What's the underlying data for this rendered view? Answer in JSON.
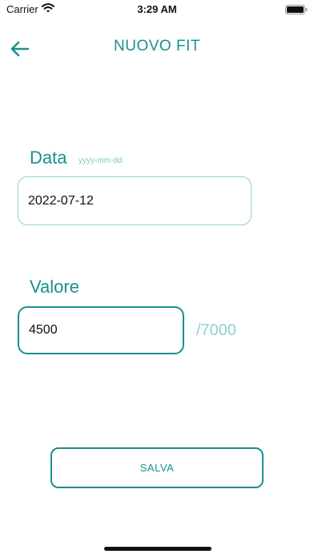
{
  "status_bar": {
    "carrier": "Carrier",
    "time": "3:29 AM",
    "wifi_icon": "wifi-icon",
    "battery_icon": "battery-icon"
  },
  "header": {
    "back_icon": "arrow-left-icon",
    "title": "NUOVO FIT"
  },
  "form": {
    "date": {
      "label": "Data",
      "hint": "yyyy-mm-dd",
      "value": "2022-07-12"
    },
    "valore": {
      "label": "Valore",
      "value": "4500",
      "max_label": "/7000"
    }
  },
  "actions": {
    "save_label": "SALVA"
  },
  "colors": {
    "accent": "#1a8f8f",
    "accent_light": "#8fd1d1",
    "background": "#ffffff",
    "text": "#111111"
  }
}
